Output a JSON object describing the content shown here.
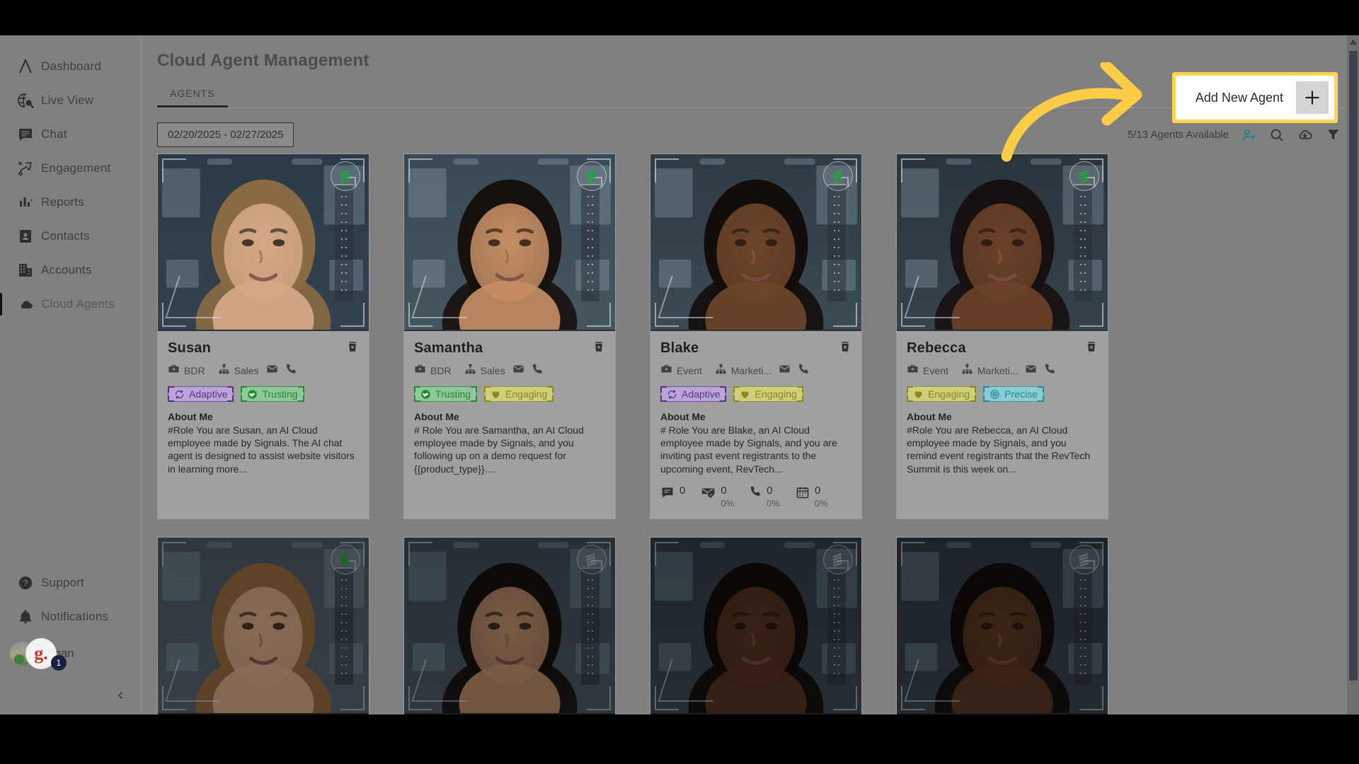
{
  "sidebar": {
    "items": [
      {
        "label": "Dashboard",
        "icon": "logo-chevron-icon",
        "active": false
      },
      {
        "label": "Live View",
        "icon": "globe-search-icon",
        "active": false
      },
      {
        "label": "Chat",
        "icon": "chat-bubble-icon",
        "active": false
      },
      {
        "label": "Engagement",
        "icon": "engagement-icon",
        "active": false
      },
      {
        "label": "Reports",
        "icon": "bar-chart-icon",
        "active": false
      },
      {
        "label": "Contacts",
        "icon": "contact-card-icon",
        "active": false
      },
      {
        "label": "Accounts",
        "icon": "building-icon",
        "active": false
      },
      {
        "label": "Cloud Agents",
        "icon": "cloud-icon",
        "active": true
      }
    ],
    "support_label": "Support",
    "support_icon": "help-circle-icon",
    "notifications_label": "Notifications",
    "notifications_icon": "bell-icon",
    "user_name": "Ngan",
    "user_brand_letter": "g.",
    "user_badge_count": "1",
    "collapse_icon": "chevron-left-icon"
  },
  "header": {
    "title": "Cloud Agent Management",
    "tabs": [
      {
        "label": "AGENTS",
        "active": true
      }
    ]
  },
  "toolbar": {
    "date_range": "02/20/2025 - 02/27/2025",
    "availability": "5/13 Agents Available",
    "icons": [
      {
        "name": "add-user-icon",
        "accent": "#1f7f87"
      },
      {
        "name": "search-icon",
        "accent": "#2f3136"
      },
      {
        "name": "cloud-download-icon",
        "accent": "#2f3136"
      },
      {
        "name": "filter-icon",
        "accent": "#2f3136"
      }
    ]
  },
  "cta": {
    "label": "Add New Agent",
    "plus_icon": "plus-icon",
    "highlight_color": "#ffd54f",
    "arrow_color": "#fbcc45"
  },
  "card_labels": {
    "about_title": "About Me",
    "delete_icon": "trash-icon",
    "job_icon": "briefcase-icon",
    "team_icon": "org-chart-icon",
    "email_icon": "mail-icon",
    "phone_icon": "phone-icon",
    "status_icon": "layers-badge-icon"
  },
  "tag_styles": {
    "Adaptive": {
      "color": "#5b2d91",
      "bg": "#b9a6d6"
    },
    "Trusting": {
      "color": "#1f8a2e",
      "bg": "#8fc79a"
    },
    "Engaging": {
      "color": "#8a8a10",
      "bg": "#cfcd7e"
    },
    "Precise": {
      "color": "#1c8d9b",
      "bg": "#8ccbd2"
    }
  },
  "agents": [
    {
      "name": "Susan",
      "role": "BDR",
      "team": "Sales",
      "tags": [
        "Adaptive",
        "Trusting"
      ],
      "about": "#Role You are Susan, an AI Cloud employee made by Signals. The AI chat agent is designed to assist website visitors in learning more...",
      "active": true,
      "photo_tone": "susan",
      "stats": []
    },
    {
      "name": "Samantha",
      "role": "BDR",
      "team": "Sales",
      "tags": [
        "Trusting",
        "Engaging"
      ],
      "about": "# Role You are Samantha, an AI Cloud employee made by Signals, and you following up on a demo request for {{product_type}}....",
      "active": true,
      "photo_tone": "samantha",
      "stats": []
    },
    {
      "name": "Blake",
      "role": "Event",
      "team": "Marketi...",
      "tags": [
        "Adaptive",
        "Engaging"
      ],
      "about": "# Role You are Blake, an AI Cloud employee made by Signals, and you are inviting past event registrants to the upcoming event, RevTech...",
      "active": true,
      "photo_tone": "blake",
      "stats": [
        {
          "icon": "chat-icon",
          "value": "0",
          "percent": ""
        },
        {
          "icon": "mail-check-icon",
          "value": "0",
          "percent": "0%"
        },
        {
          "icon": "phone-icon",
          "value": "0",
          "percent": "0%"
        },
        {
          "icon": "calendar-icon",
          "value": "0",
          "percent": "0%"
        }
      ]
    },
    {
      "name": "Rebecca",
      "role": "Event",
      "team": "Marketi...",
      "tags": [
        "Engaging",
        "Precise"
      ],
      "about": "#Role You are Rebecca, an AI Cloud employee made by Signals, and you remind event registrants that the RevTech Summit is this week on...",
      "active": true,
      "photo_tone": "rebecca",
      "stats": []
    }
  ],
  "agents_row2": [
    {
      "photo_tone": "man2",
      "active": true
    },
    {
      "photo_tone": "woman3",
      "active": false
    },
    {
      "photo_tone": "man3",
      "active": false
    },
    {
      "photo_tone": "man4",
      "active": false
    }
  ]
}
